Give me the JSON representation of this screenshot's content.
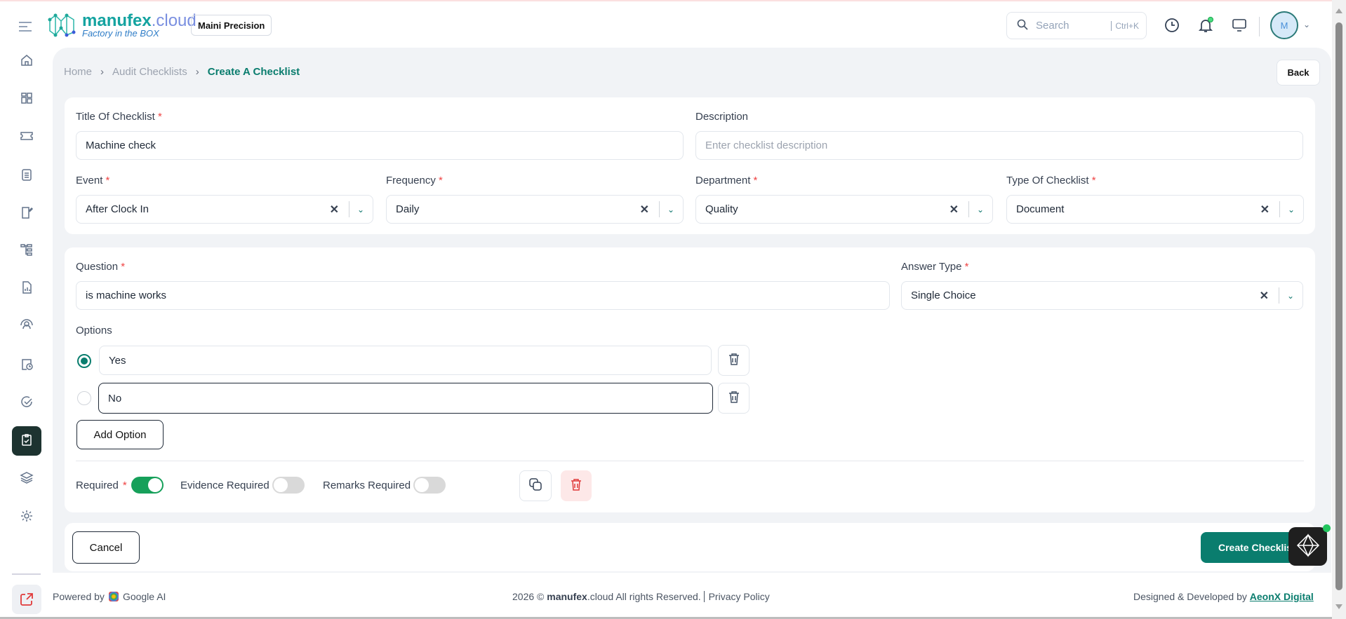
{
  "header": {
    "logo_name": "manufex",
    "logo_suffix": ".cloud",
    "logo_tagline": "Factory in the BOX",
    "org": "Maini Precision",
    "search_placeholder": "Search",
    "search_shortcut": "Ctrl+K",
    "avatar": "M"
  },
  "sidebar": [
    "home",
    "dashboard",
    "ticket",
    "clipboard-list",
    "notebook-edit",
    "hierarchy",
    "report",
    "user-sync",
    "clipboard-clock",
    "check-circle",
    "audit-checklist",
    "layers",
    "settings"
  ],
  "breadcrumb": [
    "Home",
    "Audit Checklists",
    "Create A Checklist"
  ],
  "back_label": "Back",
  "form": {
    "title_label": "Title Of Checklist",
    "title_value": "Machine check",
    "description_label": "Description",
    "description_placeholder": "Enter checklist description",
    "event_label": "Event",
    "event_value": "After Clock In",
    "frequency_label": "Frequency",
    "frequency_value": "Daily",
    "department_label": "Department",
    "department_value": "Quality",
    "type_label": "Type Of Checklist",
    "type_value": "Document"
  },
  "question": {
    "question_label": "Question",
    "question_value": "is machine works",
    "answer_type_label": "Answer Type",
    "answer_type_value": "Single Choice",
    "options_label": "Options",
    "options": [
      {
        "value": "Yes",
        "selected": true
      },
      {
        "value": "No",
        "selected": false
      }
    ],
    "add_option": "Add Option",
    "required_label": "Required",
    "required": true,
    "evidence_label": "Evidence Required",
    "evidence": false,
    "remarks_label": "Remarks Required",
    "remarks": false
  },
  "actions": {
    "cancel": "Cancel",
    "create": "Create Checklist"
  },
  "footer": {
    "powered_by": "Powered by",
    "google_ai": "Google AI",
    "copyright_pre": "2026 ©",
    "brand": "manufex",
    "brand_suffix": ".cloud",
    "rights": "All rights Reserved.",
    "privacy": "Privacy Policy",
    "designed": "Designed & Developed by",
    "company": "AeonX Digital"
  },
  "colors": {
    "accent": "#0a7d6e",
    "sidebar_active": "#1d3330",
    "toggle_on": "#16a05a",
    "danger": "#ef4444"
  }
}
